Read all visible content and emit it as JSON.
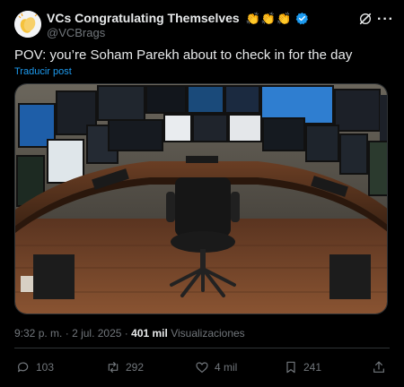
{
  "author": {
    "name": "VCs Congratulating Themselves",
    "handle": "@VCBrags"
  },
  "tweet": {
    "text": "POV: you’re Soham Parekh about to check in for the day",
    "translate_label": "Traducir post"
  },
  "media": {
    "icon": "photo-of-trading-desk-with-many-monitors"
  },
  "meta": {
    "time": "9:32 p. m.",
    "separator": "·",
    "date": "2 jul. 2025",
    "views_count": "401 mil",
    "views_label": "Visualizaciones"
  },
  "actions": {
    "replies": "103",
    "reposts": "292",
    "likes": "4 mil",
    "bookmarks": "241"
  },
  "colors": {
    "background": "#000000",
    "text": "#e7e9ea",
    "muted": "#71767b",
    "link": "#1d9bf0",
    "verified": "#1d9bf0"
  }
}
